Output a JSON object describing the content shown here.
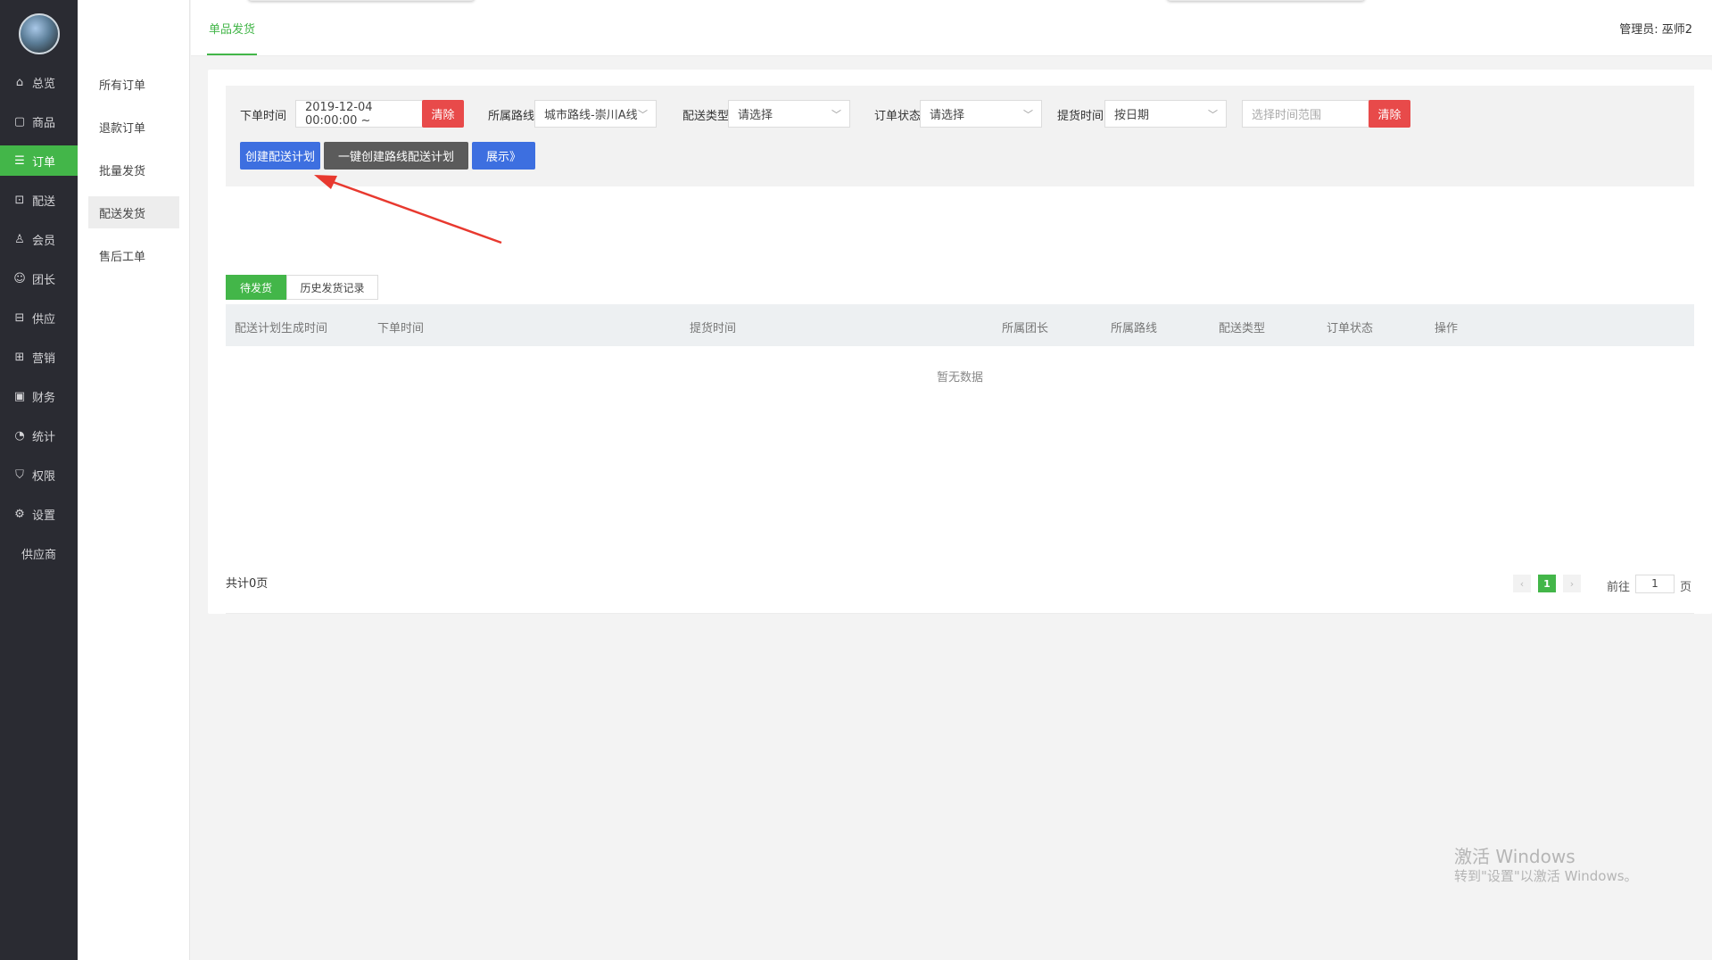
{
  "sidebar": {
    "items": [
      {
        "label": "总览",
        "icon": "home-icon",
        "glyph": "⌂"
      },
      {
        "label": "商品",
        "icon": "shop-icon",
        "glyph": "▢"
      },
      {
        "label": "订单",
        "icon": "order-icon",
        "glyph": "☰"
      },
      {
        "label": "配送",
        "icon": "delivery-icon",
        "glyph": "⊡"
      },
      {
        "label": "会员",
        "icon": "member-icon",
        "glyph": "♙"
      },
      {
        "label": "团长",
        "icon": "leader-icon",
        "glyph": "☺"
      },
      {
        "label": "供应",
        "icon": "supply-icon",
        "glyph": "⊟"
      },
      {
        "label": "营销",
        "icon": "gift-icon",
        "glyph": "⊞"
      },
      {
        "label": "财务",
        "icon": "finance-icon",
        "glyph": "▣"
      },
      {
        "label": "统计",
        "icon": "chart-icon",
        "glyph": "◔"
      },
      {
        "label": "权限",
        "icon": "shield-icon",
        "glyph": "⛉"
      },
      {
        "label": "设置",
        "icon": "gear-icon",
        "glyph": "⚙"
      },
      {
        "label": "供应商",
        "icon": "",
        "glyph": ""
      }
    ],
    "active": "订单"
  },
  "subnav": {
    "items": [
      "所有订单",
      "退款订单",
      "批量发货",
      "配送发货",
      "售后工单"
    ],
    "active": "配送发货"
  },
  "topbar": {
    "tab": "单品发货",
    "admin_label": "管理员:",
    "admin_name": "巫师2"
  },
  "filters": {
    "order_time_label": "下单时间",
    "order_time_value": "2019-12-04 00:00:00 ~",
    "clear1": "清除",
    "route_label": "所属路线",
    "route_value": "城市路线-崇川A线",
    "delivery_type_label": "配送类型",
    "delivery_type_value": "请选择",
    "order_status_label": "订单状态",
    "order_status_value": "请选择",
    "pickup_time_label": "提货时间",
    "pickup_time_value": "按日期",
    "range_placeholder": "选择时间范围",
    "clear2": "清除"
  },
  "actions": {
    "create_plan": "创建配送计划",
    "one_click_create": "一键创建路线配送计划",
    "show": "展示》"
  },
  "tabs": [
    "待发货",
    "历史发货记录"
  ],
  "table": {
    "columns": [
      "配送计划生成时间",
      "下单时间",
      "提货时间",
      "所属团长",
      "所属路线",
      "配送类型",
      "订单状态",
      "操作"
    ],
    "empty": "暂无数据"
  },
  "pagination": {
    "total": "共计0页",
    "prev": "‹",
    "current": "1",
    "next": "›",
    "goto_label": "前往",
    "goto_value": "1",
    "page_unit": "页"
  },
  "watermark": {
    "line1": "激活 Windows",
    "line2": "转到\"设置\"以激活 Windows。"
  },
  "colors": {
    "accent": "#43b649",
    "sidebar_bg": "#2a2b32",
    "danger": "#e84a4a",
    "primary": "#3d6fe0",
    "dark_button": "#5b5b5b",
    "annotation_arrow": "#e8392f"
  }
}
